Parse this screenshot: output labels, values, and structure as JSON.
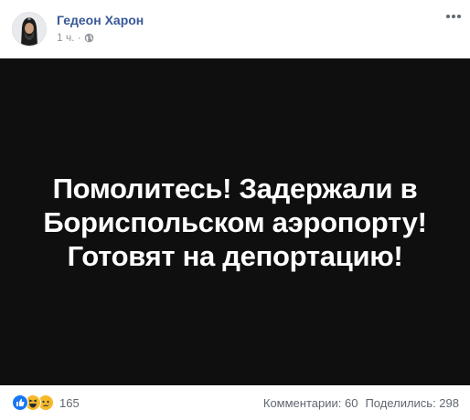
{
  "post": {
    "author": "Гедеон Харон",
    "time": "1 ч.",
    "separator": "·",
    "privacy_icon": "globe-icon",
    "more_icon": "more-options-icon",
    "image": {
      "background": "#0f0f0f",
      "text_color": "#ffffff",
      "text": "Помолитесь! Задержали в\nБориспольском аэропорту!\nГотовят на депортацию!"
    },
    "reactions": {
      "icons": [
        "like-icon",
        "haha-icon",
        "sad-icon"
      ],
      "count": "165"
    },
    "comments": "Комментарии: 60",
    "shares": "Поделились: 298"
  },
  "colors": {
    "author_link": "#385898",
    "meta_text": "#90949c",
    "like": "#1877f2",
    "emoji": "#f7b928"
  }
}
